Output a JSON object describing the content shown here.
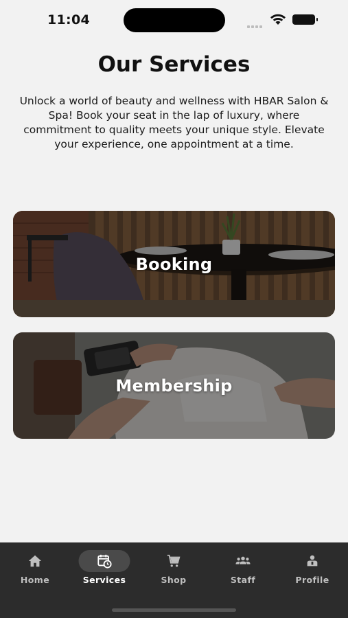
{
  "status_bar": {
    "time": "11:04"
  },
  "page": {
    "title": "Our Services",
    "intro": "Unlock a world of beauty and wellness with HBAR Salon & Spa! Book your seat in the lap of luxury, where commitment to quality meets your unique style. Elevate your experience, one appointment at a time."
  },
  "services": [
    {
      "label": "Booking"
    },
    {
      "label": "Membership"
    }
  ],
  "tab_bar": {
    "active": "Services",
    "items": [
      {
        "label": "Home",
        "icon": "home-icon"
      },
      {
        "label": "Services",
        "icon": "calendar-clock-icon"
      },
      {
        "label": "Shop",
        "icon": "cart-icon"
      },
      {
        "label": "Staff",
        "icon": "group-icon"
      },
      {
        "label": "Profile",
        "icon": "person-badge-icon"
      }
    ]
  },
  "colors": {
    "background": "#f2f2f2",
    "tab_bar": "#2c2c2c",
    "tab_active_pill": "#4a4a4a",
    "card_overlay": "rgba(0,0,0,0.45)"
  }
}
